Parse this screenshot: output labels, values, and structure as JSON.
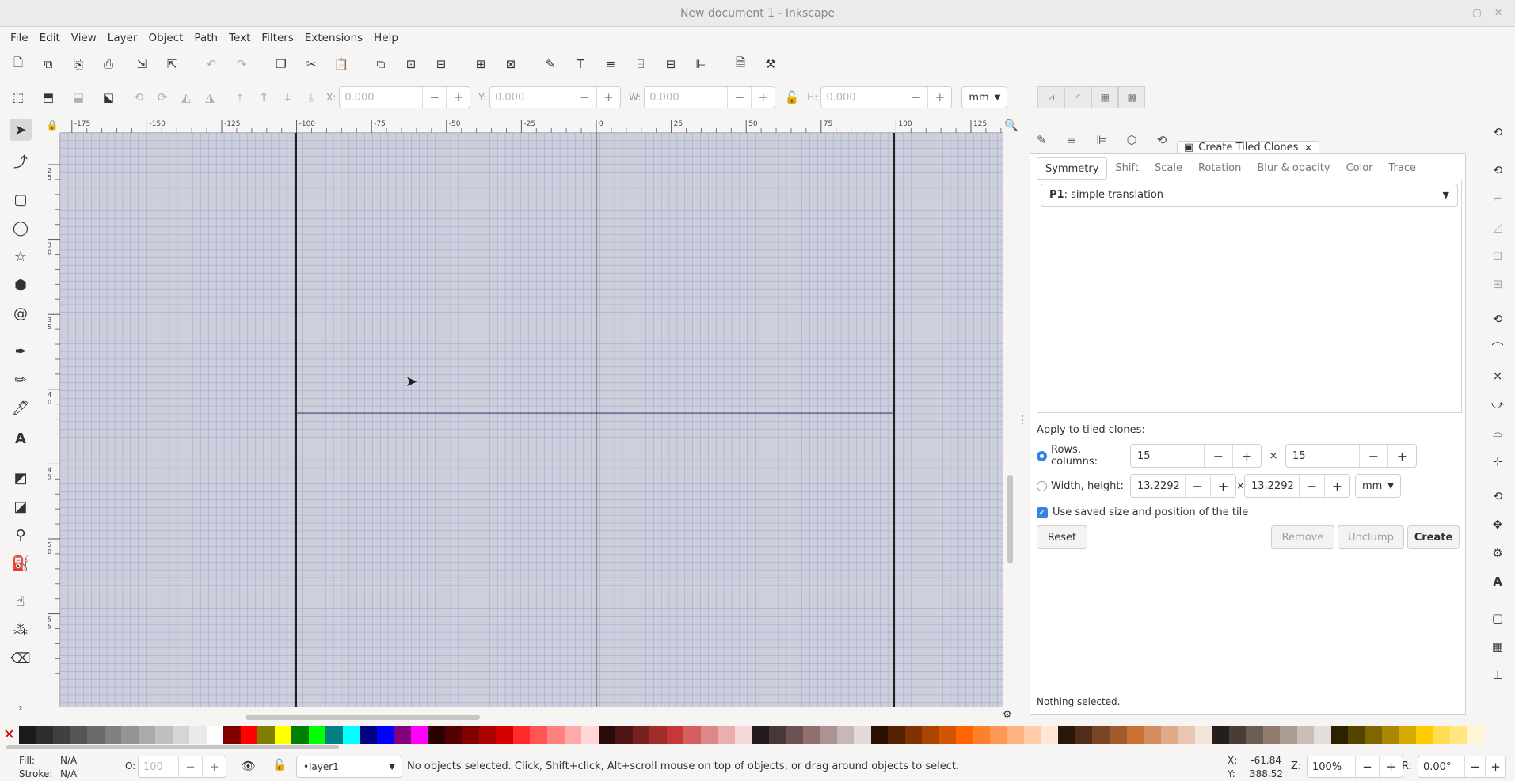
{
  "window": {
    "title": "New document 1 - Inkscape",
    "min_icon": "minimize-icon",
    "max_icon": "maximize-icon",
    "close_icon": "close-icon"
  },
  "menu": [
    "File",
    "Edit",
    "View",
    "Layer",
    "Object",
    "Path",
    "Text",
    "Filters",
    "Extensions",
    "Help"
  ],
  "toolbar_commands": [
    "new-document-icon",
    "open-icon",
    "open-template-icon",
    "print-icon",
    "import-icon",
    "export-icon",
    "undo-icon",
    "redo-icon",
    "copy-icon",
    "cut-icon",
    "paste-icon",
    "duplicate-icon",
    "clone-icon",
    "unlink-clone-icon",
    "group-icon",
    "ungroup-icon",
    "fill-stroke-icon",
    "text-font-icon",
    "layers-icon",
    "xml-editor-icon",
    "align-distribute-icon",
    "transform-icon",
    "document-properties-icon",
    "preferences-icon"
  ],
  "selector_bar": {
    "x_label": "X:",
    "x_value": "0.000",
    "y_label": "Y:",
    "y_value": "0.000",
    "w_label": "W:",
    "w_value": "0.000",
    "h_label": "H:",
    "h_value": "0.000",
    "unit": "mm",
    "minus": "−",
    "plus": "+"
  },
  "ruler": {
    "top_labels": [
      "-175",
      "-150",
      "-125",
      "-100",
      "-75",
      "-50",
      "-25",
      "0",
      "25",
      "50",
      "75",
      "100",
      "125"
    ],
    "left_labels": [
      "2\n5",
      "3\n0",
      "3\n5",
      "4\n0",
      "4\n5",
      "5\n0",
      "5\n5"
    ]
  },
  "dock": {
    "tab_title": "Create Tiled Clones",
    "tab_icons": [
      "fill-stroke-icon",
      "layers-icon",
      "objects-icon",
      "symbols-icon",
      "history-icon"
    ],
    "tabs": [
      "Symmetry",
      "Shift",
      "Scale",
      "Rotation",
      "Blur & opacity",
      "Color",
      "Trace"
    ],
    "symmetry_bold": "P1",
    "symmetry_rest": ": simple translation",
    "apply_label": "Apply to tiled clones:",
    "rows_columns_label": "Rows, columns:",
    "rows": "15",
    "columns": "15",
    "times": "×",
    "width_height_label": "Width, height:",
    "width": "13.2292",
    "height": "13.2292",
    "wh_unit": "mm",
    "use_saved_label": "Use saved size and position of the tile",
    "reset": "Reset",
    "remove": "Remove",
    "unclump": "Unclump",
    "create": "Create",
    "status": "Nothing selected."
  },
  "statusbar": {
    "fill_label": "Fill:",
    "fill_value": "N/A",
    "stroke_label": "Stroke:",
    "stroke_value": "N/A",
    "opacity_label": "O:",
    "opacity_value": "100",
    "layer": "•layer1",
    "message": "No objects selected. Click, Shift+click, Alt+scroll mouse on top of objects, or drag around objects to select.",
    "x_label": "X:",
    "x_value": "-61.84",
    "y_label": "Y:",
    "y_value": "388.52",
    "zoom_label": "Z:",
    "zoom_value": "100%",
    "rotation_label": "R:",
    "rotation_value": "0.00°"
  },
  "palette": [
    "#1a1a1a",
    "#2d2d2d",
    "#404040",
    "#555555",
    "#6a6a6a",
    "#808080",
    "#959595",
    "#aaaaaa",
    "#bfbfbf",
    "#d5d5d5",
    "#eaeaea",
    "#ffffff",
    "#800000",
    "#ff0000",
    "#808000",
    "#ffff00",
    "#008000",
    "#00ff00",
    "#008080",
    "#00ffff",
    "#000080",
    "#0000ff",
    "#800080",
    "#ff00ff",
    "#2b0000",
    "#550000",
    "#800000",
    "#aa0000",
    "#d40000",
    "#ff2a2a",
    "#ff5555",
    "#ff8080",
    "#ffaaaa",
    "#ffd5d5",
    "#280b0b",
    "#501616",
    "#782121",
    "#a02c2c",
    "#c83737",
    "#d35f5f",
    "#de8787",
    "#e9afaf",
    "#f4d7d7",
    "#241c1c",
    "#483737",
    "#6c5353",
    "#916f6f",
    "#ac9393",
    "#c8b7b7",
    "#e3dbdb",
    "#2b1100",
    "#552200",
    "#803300",
    "#aa4400",
    "#d45500",
    "#ff6600",
    "#ff7f2a",
    "#ff9955",
    "#ffb380",
    "#ffccaa",
    "#ffe6d5",
    "#28170b",
    "#502d16",
    "#784421",
    "#a05a2c",
    "#c87137",
    "#d38d5f",
    "#deaa87",
    "#e9c6af",
    "#f4e3d7",
    "#241f1c",
    "#483e37",
    "#6c5d53",
    "#917c6f",
    "#ac9d93",
    "#c8beb7",
    "#e3dedb",
    "#2b2200",
    "#554400",
    "#806600",
    "#aa8800",
    "#d4aa00",
    "#ffcc00",
    "#ffdd55",
    "#ffe680",
    "#fff6d5"
  ],
  "colors": {
    "page_border": "#202020",
    "grid": "#8a8ed8",
    "desk": "#cdcfda",
    "accent": "#3584e4"
  }
}
